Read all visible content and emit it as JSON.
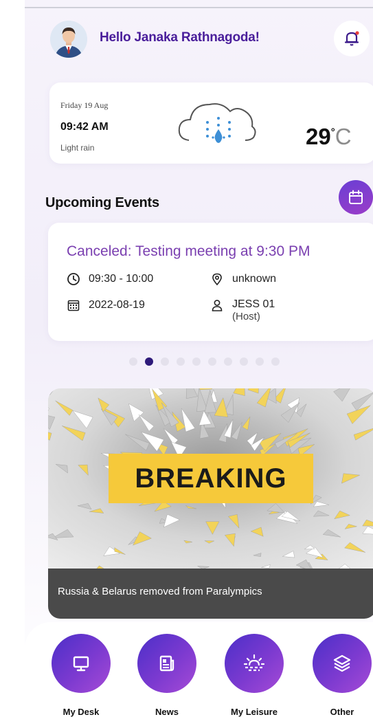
{
  "header": {
    "greeting": "Hello Janaka Rathnagoda!"
  },
  "weather": {
    "date": "Friday 19 Aug",
    "time": "09:42 AM",
    "condition": "Light rain",
    "temperature": "29",
    "degree_symbol": "°",
    "unit": "C",
    "icon": "cloud-rain-icon"
  },
  "events": {
    "section_title": "Upcoming Events",
    "title": "Canceled: Testing meeting at 9:30 PM",
    "time": "09:30 - 10:00",
    "location": "unknown",
    "date": "2022-08-19",
    "host_name": "JESS 01",
    "host_role": "(Host)",
    "carousel_total": 10,
    "carousel_active_index": 1
  },
  "banner": {
    "label": "BREAKING",
    "headline": "Russia & Belarus removed from Paralympics"
  },
  "nav": {
    "items": [
      {
        "label": "My Desk",
        "icon": "monitor-icon"
      },
      {
        "label": "News",
        "icon": "newspaper-icon"
      },
      {
        "label": "My Leisure",
        "icon": "sunrise-icon"
      },
      {
        "label": "Other",
        "icon": "layers-icon"
      }
    ]
  },
  "colors": {
    "accent": "#4a1e9b",
    "event_title": "#7a3fb0",
    "active_dot": "#2e1a7a",
    "banner_highlight": "#f6c93a"
  }
}
